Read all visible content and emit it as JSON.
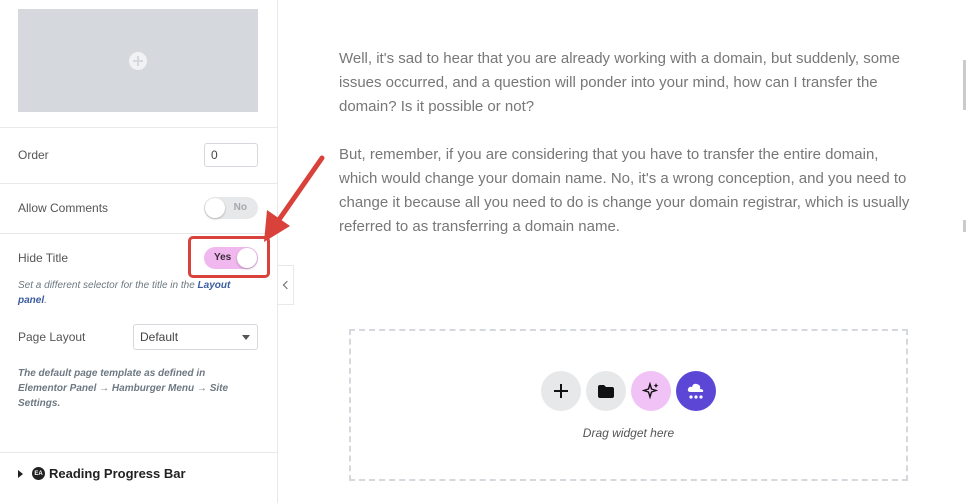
{
  "sidebar": {
    "order": {
      "label": "Order",
      "value": "0"
    },
    "allow_comments": {
      "label": "Allow Comments",
      "toggle_text": "No"
    },
    "hide_title": {
      "label": "Hide Title",
      "toggle_text": "Yes",
      "help_prefix": "Set a different selector for the title in the",
      "help_link": "Layout panel",
      "help_suffix": "."
    },
    "page_layout": {
      "label": "Page Layout",
      "selected": "Default",
      "help": "The default page template as defined in Elementor Panel → Hamburger Menu → Site Settings."
    },
    "section": {
      "badge": "EA",
      "title": "Reading Progress Bar"
    }
  },
  "content": {
    "paragraphs": [
      "Well, it's sad to hear that you are already working with a domain, but suddenly, some issues occurred, and a question will ponder into your mind, how can I transfer the domain? Is it possible or not?",
      "But, remember, if you are considering that you have to transfer the entire domain, which would change your domain name. No, it's a wrong conception, and you need to change it because all you need to do is change your domain registrar, which is usually referred to as transferring a domain name."
    ],
    "drop_zone": {
      "label": "Drag widget here",
      "buttons": [
        "add-icon",
        "folder-icon",
        "ai-sparkle-icon",
        "cloud-icon"
      ]
    }
  },
  "colors": {
    "toggle_on": "#f0b8ee",
    "highlight": "#d9413b",
    "ai_button": "#f1c2f5",
    "cloud_button": "#5b46d6",
    "link": "#3a5c9e"
  }
}
